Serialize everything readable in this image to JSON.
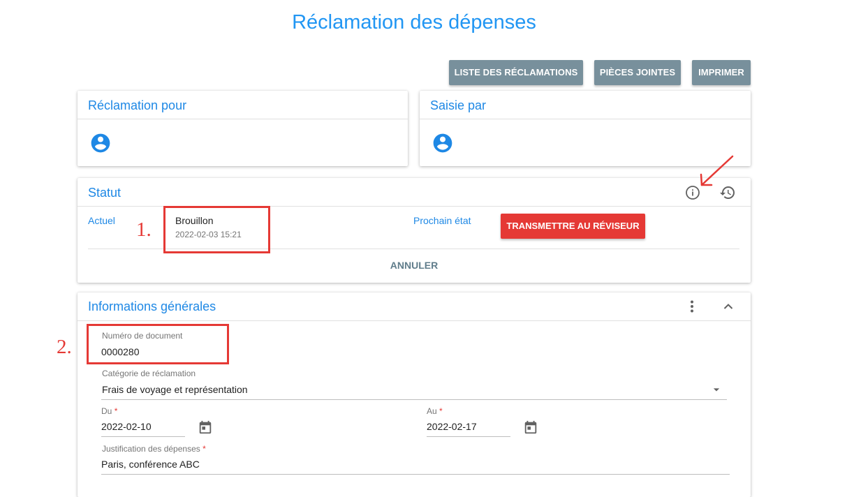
{
  "page": {
    "title": "Réclamation des dépenses"
  },
  "toolbar": {
    "list_label": "LISTE DES RÉCLAMATIONS",
    "attachments_label": "PIÈCES JOINTES",
    "print_label": "IMPRIMER"
  },
  "claim_for": {
    "title": "Réclamation pour",
    "icon": "account-circle-icon"
  },
  "entered_by": {
    "title": "Saisie par",
    "icon": "account-circle-icon"
  },
  "status": {
    "title": "Statut",
    "current_label": "Actuel",
    "current_value": "Brouillon",
    "current_timestamp": "2022-02-03 15:21",
    "next_label": "Prochain état",
    "transmit_label": "TRANSMETTRE AU RÉVISEUR",
    "cancel_label": "ANNULER",
    "info_icon": "info-icon",
    "history_icon": "history-icon"
  },
  "general": {
    "title": "Informations générales",
    "doc_number_label": "Numéro de document",
    "doc_number_value": "0000280",
    "category_label": "Catégorie de réclamation",
    "category_value": "Frais de voyage et représentation",
    "from_label": "Du",
    "from_value": "2022-02-10",
    "to_label": "Au",
    "to_value": "2022-02-17",
    "justification_label": "Justification des dépenses",
    "justification_value": "Paris, conférence ABC",
    "required_mark": "*"
  },
  "annotations": {
    "first": "1.",
    "second": "2."
  },
  "colors": {
    "accent": "#2196f3",
    "toolbar_button": "#78909c",
    "transmit_button": "#e53935",
    "annotation_red": "#e53935"
  }
}
